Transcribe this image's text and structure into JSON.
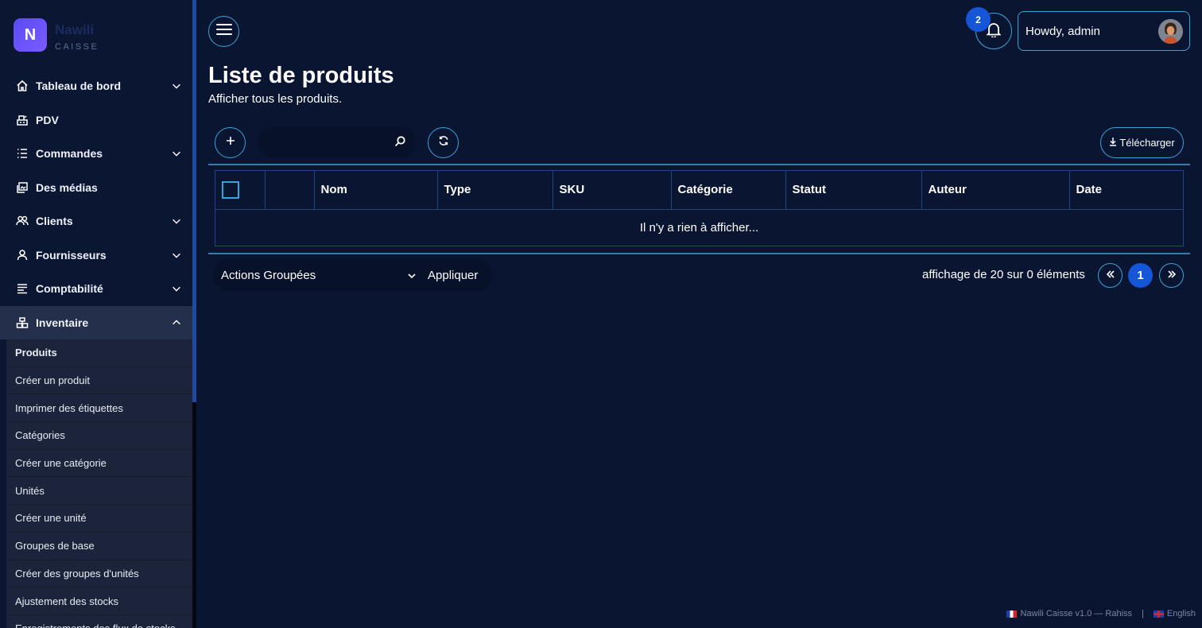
{
  "brand": {
    "logo_letter": "N",
    "name": "Nawili",
    "subtitle": "CAISSE"
  },
  "sidebar": {
    "items": [
      {
        "label": "Tableau de bord",
        "icon": "home-icon",
        "has_chevron": true
      },
      {
        "label": "PDV",
        "icon": "pos-icon",
        "has_chevron": false
      },
      {
        "label": "Commandes",
        "icon": "list-icon",
        "has_chevron": true
      },
      {
        "label": "Des médias",
        "icon": "media-icon",
        "has_chevron": false
      },
      {
        "label": "Clients",
        "icon": "users-icon",
        "has_chevron": true
      },
      {
        "label": "Fournisseurs",
        "icon": "user-icon",
        "has_chevron": true
      },
      {
        "label": "Comptabilité",
        "icon": "accounting-icon",
        "has_chevron": true
      },
      {
        "label": "Inventaire",
        "icon": "inventory-icon",
        "has_chevron": true,
        "expanded": true
      }
    ],
    "submenu": [
      "Produits",
      "Créer un produit",
      "Imprimer des étiquettes",
      "Catégories",
      "Créer une catégorie",
      "Unités",
      "Créer une unité",
      "Groupes de base",
      "Créer des groupes d'unités",
      "Ajustement des stocks",
      "Enregistrements des flux de stocks"
    ]
  },
  "header": {
    "notification_count": "2",
    "greeting": "Howdy, admin"
  },
  "page": {
    "title": "Liste de produits",
    "subtitle": "Afficher tous les produits."
  },
  "toolbar": {
    "search_placeholder": "",
    "download_label": "Télécharger"
  },
  "table": {
    "columns": [
      "Nom",
      "Type",
      "SKU",
      "Catégorie",
      "Statut",
      "Auteur",
      "Date"
    ],
    "empty_message": "Il n'y a rien à afficher..."
  },
  "footer_bar": {
    "bulk_actions_label": "Actions Groupées",
    "apply_label": "Appliquer",
    "paging_text": "affichage de 20 sur 0 éléments",
    "current_page": "1"
  },
  "footer": {
    "credit": "Nawili Caisse v1.0 — Rahiss",
    "separator": "|",
    "language": "English"
  },
  "colors": {
    "background": "#0a1532",
    "accent_border": "#3aa3d6",
    "primary": "#1556d8",
    "logo": "#5b4bf5"
  }
}
